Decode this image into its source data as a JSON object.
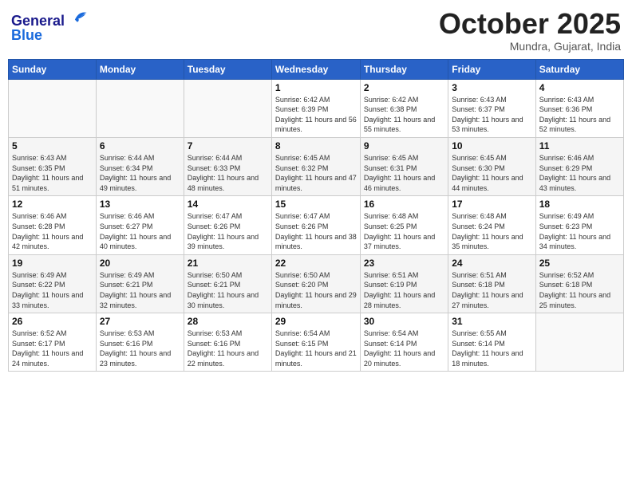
{
  "header": {
    "logo_general": "General",
    "logo_blue": "Blue",
    "month_title": "October 2025",
    "subtitle": "Mundra, Gujarat, India"
  },
  "days_of_week": [
    "Sunday",
    "Monday",
    "Tuesday",
    "Wednesday",
    "Thursday",
    "Friday",
    "Saturday"
  ],
  "weeks": [
    [
      {
        "day": "",
        "sunrise": "",
        "sunset": "",
        "daylight": ""
      },
      {
        "day": "",
        "sunrise": "",
        "sunset": "",
        "daylight": ""
      },
      {
        "day": "",
        "sunrise": "",
        "sunset": "",
        "daylight": ""
      },
      {
        "day": "1",
        "sunrise": "Sunrise: 6:42 AM",
        "sunset": "Sunset: 6:39 PM",
        "daylight": "Daylight: 11 hours and 56 minutes."
      },
      {
        "day": "2",
        "sunrise": "Sunrise: 6:42 AM",
        "sunset": "Sunset: 6:38 PM",
        "daylight": "Daylight: 11 hours and 55 minutes."
      },
      {
        "day": "3",
        "sunrise": "Sunrise: 6:43 AM",
        "sunset": "Sunset: 6:37 PM",
        "daylight": "Daylight: 11 hours and 53 minutes."
      },
      {
        "day": "4",
        "sunrise": "Sunrise: 6:43 AM",
        "sunset": "Sunset: 6:36 PM",
        "daylight": "Daylight: 11 hours and 52 minutes."
      }
    ],
    [
      {
        "day": "5",
        "sunrise": "Sunrise: 6:43 AM",
        "sunset": "Sunset: 6:35 PM",
        "daylight": "Daylight: 11 hours and 51 minutes."
      },
      {
        "day": "6",
        "sunrise": "Sunrise: 6:44 AM",
        "sunset": "Sunset: 6:34 PM",
        "daylight": "Daylight: 11 hours and 49 minutes."
      },
      {
        "day": "7",
        "sunrise": "Sunrise: 6:44 AM",
        "sunset": "Sunset: 6:33 PM",
        "daylight": "Daylight: 11 hours and 48 minutes."
      },
      {
        "day": "8",
        "sunrise": "Sunrise: 6:45 AM",
        "sunset": "Sunset: 6:32 PM",
        "daylight": "Daylight: 11 hours and 47 minutes."
      },
      {
        "day": "9",
        "sunrise": "Sunrise: 6:45 AM",
        "sunset": "Sunset: 6:31 PM",
        "daylight": "Daylight: 11 hours and 46 minutes."
      },
      {
        "day": "10",
        "sunrise": "Sunrise: 6:45 AM",
        "sunset": "Sunset: 6:30 PM",
        "daylight": "Daylight: 11 hours and 44 minutes."
      },
      {
        "day": "11",
        "sunrise": "Sunrise: 6:46 AM",
        "sunset": "Sunset: 6:29 PM",
        "daylight": "Daylight: 11 hours and 43 minutes."
      }
    ],
    [
      {
        "day": "12",
        "sunrise": "Sunrise: 6:46 AM",
        "sunset": "Sunset: 6:28 PM",
        "daylight": "Daylight: 11 hours and 42 minutes."
      },
      {
        "day": "13",
        "sunrise": "Sunrise: 6:46 AM",
        "sunset": "Sunset: 6:27 PM",
        "daylight": "Daylight: 11 hours and 40 minutes."
      },
      {
        "day": "14",
        "sunrise": "Sunrise: 6:47 AM",
        "sunset": "Sunset: 6:26 PM",
        "daylight": "Daylight: 11 hours and 39 minutes."
      },
      {
        "day": "15",
        "sunrise": "Sunrise: 6:47 AM",
        "sunset": "Sunset: 6:26 PM",
        "daylight": "Daylight: 11 hours and 38 minutes."
      },
      {
        "day": "16",
        "sunrise": "Sunrise: 6:48 AM",
        "sunset": "Sunset: 6:25 PM",
        "daylight": "Daylight: 11 hours and 37 minutes."
      },
      {
        "day": "17",
        "sunrise": "Sunrise: 6:48 AM",
        "sunset": "Sunset: 6:24 PM",
        "daylight": "Daylight: 11 hours and 35 minutes."
      },
      {
        "day": "18",
        "sunrise": "Sunrise: 6:49 AM",
        "sunset": "Sunset: 6:23 PM",
        "daylight": "Daylight: 11 hours and 34 minutes."
      }
    ],
    [
      {
        "day": "19",
        "sunrise": "Sunrise: 6:49 AM",
        "sunset": "Sunset: 6:22 PM",
        "daylight": "Daylight: 11 hours and 33 minutes."
      },
      {
        "day": "20",
        "sunrise": "Sunrise: 6:49 AM",
        "sunset": "Sunset: 6:21 PM",
        "daylight": "Daylight: 11 hours and 32 minutes."
      },
      {
        "day": "21",
        "sunrise": "Sunrise: 6:50 AM",
        "sunset": "Sunset: 6:21 PM",
        "daylight": "Daylight: 11 hours and 30 minutes."
      },
      {
        "day": "22",
        "sunrise": "Sunrise: 6:50 AM",
        "sunset": "Sunset: 6:20 PM",
        "daylight": "Daylight: 11 hours and 29 minutes."
      },
      {
        "day": "23",
        "sunrise": "Sunrise: 6:51 AM",
        "sunset": "Sunset: 6:19 PM",
        "daylight": "Daylight: 11 hours and 28 minutes."
      },
      {
        "day": "24",
        "sunrise": "Sunrise: 6:51 AM",
        "sunset": "Sunset: 6:18 PM",
        "daylight": "Daylight: 11 hours and 27 minutes."
      },
      {
        "day": "25",
        "sunrise": "Sunrise: 6:52 AM",
        "sunset": "Sunset: 6:18 PM",
        "daylight": "Daylight: 11 hours and 25 minutes."
      }
    ],
    [
      {
        "day": "26",
        "sunrise": "Sunrise: 6:52 AM",
        "sunset": "Sunset: 6:17 PM",
        "daylight": "Daylight: 11 hours and 24 minutes."
      },
      {
        "day": "27",
        "sunrise": "Sunrise: 6:53 AM",
        "sunset": "Sunset: 6:16 PM",
        "daylight": "Daylight: 11 hours and 23 minutes."
      },
      {
        "day": "28",
        "sunrise": "Sunrise: 6:53 AM",
        "sunset": "Sunset: 6:16 PM",
        "daylight": "Daylight: 11 hours and 22 minutes."
      },
      {
        "day": "29",
        "sunrise": "Sunrise: 6:54 AM",
        "sunset": "Sunset: 6:15 PM",
        "daylight": "Daylight: 11 hours and 21 minutes."
      },
      {
        "day": "30",
        "sunrise": "Sunrise: 6:54 AM",
        "sunset": "Sunset: 6:14 PM",
        "daylight": "Daylight: 11 hours and 20 minutes."
      },
      {
        "day": "31",
        "sunrise": "Sunrise: 6:55 AM",
        "sunset": "Sunset: 6:14 PM",
        "daylight": "Daylight: 11 hours and 18 minutes."
      },
      {
        "day": "",
        "sunrise": "",
        "sunset": "",
        "daylight": ""
      }
    ]
  ]
}
